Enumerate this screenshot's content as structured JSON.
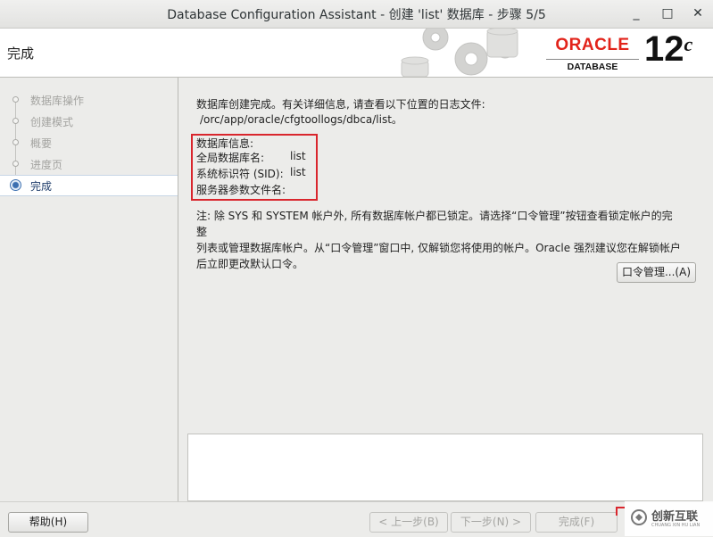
{
  "window": {
    "title": "Database Configuration Assistant - 创建 'list' 数据库 - 步骤 5/5",
    "minimize": "_",
    "maximize": "□",
    "close": "✕"
  },
  "header": {
    "page_title": "完成",
    "oracle_word": "ORACLE",
    "oracle_sub": "DATABASE",
    "version": "12",
    "version_sup": "c"
  },
  "steps": [
    {
      "label": "数据库操作",
      "state": "done"
    },
    {
      "label": "创建模式",
      "state": "done"
    },
    {
      "label": "概要",
      "state": "done"
    },
    {
      "label": "进度页",
      "state": "done"
    },
    {
      "label": "完成",
      "state": "active"
    }
  ],
  "main": {
    "completed_msg": "数据库创建完成。有关详细信息, 请查看以下位置的日志文件:",
    "log_path": "/orc/app/oracle/cfgtoollogs/dbca/list。",
    "db_info_title": "数据库信息:",
    "global_db_name_label": "全局数据库名:",
    "global_db_name_value": "list",
    "sid_label": "系统标识符 (SID):",
    "sid_value": "list",
    "spfile_label": "服务器参数文件名:",
    "note_line1": "注: 除 SYS 和 SYSTEM 帐户外, 所有数据库帐户都已锁定。请选择“口令管理”按钮查看锁定帐户的完整",
    "note_line2": "列表或管理数据库帐户。从“口令管理”窗口中, 仅解锁您将使用的帐户。Oracle 强烈建议您在解锁帐户",
    "note_line3": "后立即更改默认口令。",
    "password_mgmt_button": "口令管理...(A)"
  },
  "footer": {
    "help_button": "帮助(H)",
    "back_button": "< 上一步(B)",
    "next_button": "下一步(N) >",
    "finish_button": "完成(F)"
  },
  "watermark": {
    "text": "创新互联",
    "sub": "CHUANG XIN HU LIAN"
  },
  "colors": {
    "oracle_red": "#e2231a",
    "highlight_red": "#d9262d",
    "active_step": "#1f3d6b"
  }
}
